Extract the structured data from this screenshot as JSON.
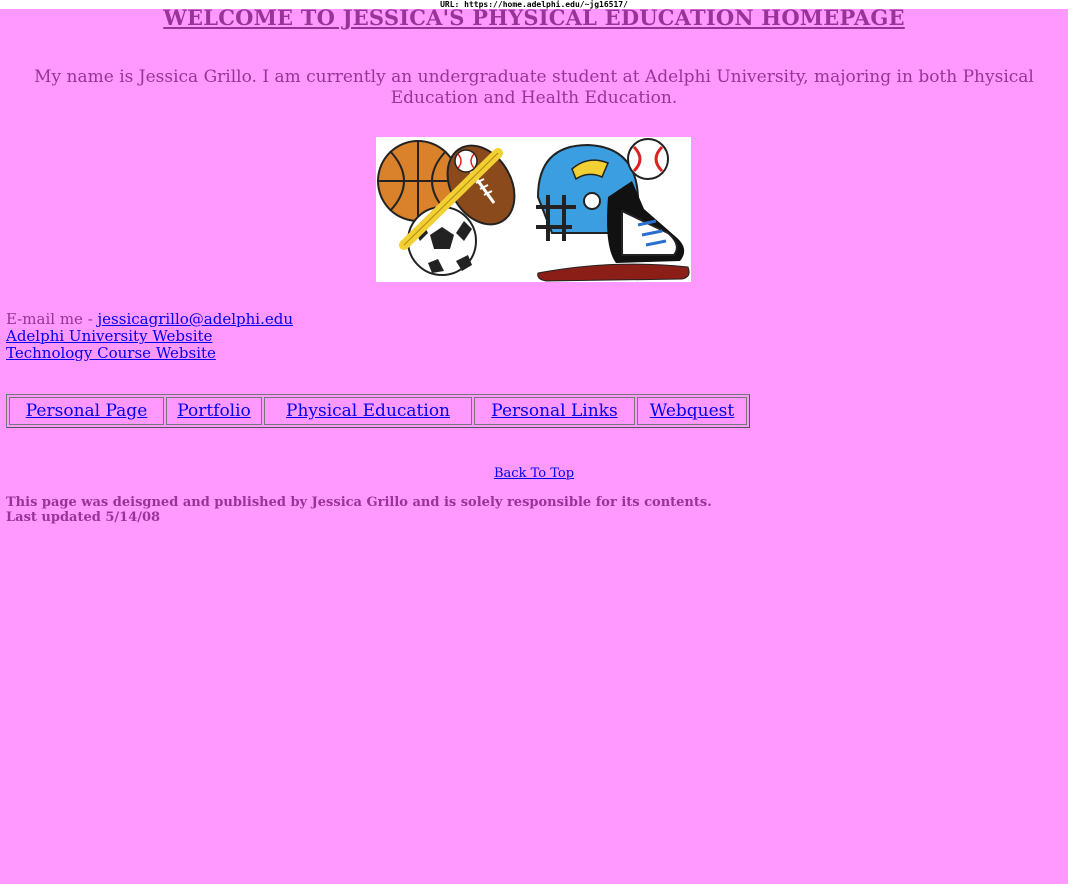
{
  "browser": {
    "url_text": "URL: https://home.adelphi.edu/~jg16517/"
  },
  "page": {
    "title": "WELCOME TO JESSICA'S PHYSICAL EDUCATION HOMEPAGE",
    "intro": "My name is Jessica Grillo. I am currently an undergraduate student at Adelphi University, majoring in both Physical Education and Health Education.",
    "email_label": "E-mail me - ",
    "email_link": " jessicagrillo@adelphi.edu",
    "adelphi_link": "Adelphi University Website",
    "tech_link": "Technology Course Website",
    "nav": [
      {
        "label": "Personal Page"
      },
      {
        "label": "Portfolio"
      },
      {
        "label": "Physical Education"
      },
      {
        "label": "Personal Links"
      },
      {
        "label": "Webquest"
      }
    ],
    "back_to_top": "Back To Top",
    "footer_line1": "This page was deisgned and published by Jessica Grillo and is solely responsible for its contents.",
    "footer_line2": "Last updated 5/14/08",
    "colors": {
      "background": "#ff99ff",
      "text": "#993399",
      "link": "#0000ee"
    },
    "banner_icons": [
      "basketball-icon",
      "baseball-bat-icon",
      "football-icon",
      "baseball-icon",
      "soccer-ball-icon",
      "football-helmet-icon",
      "sneaker-icon"
    ]
  }
}
